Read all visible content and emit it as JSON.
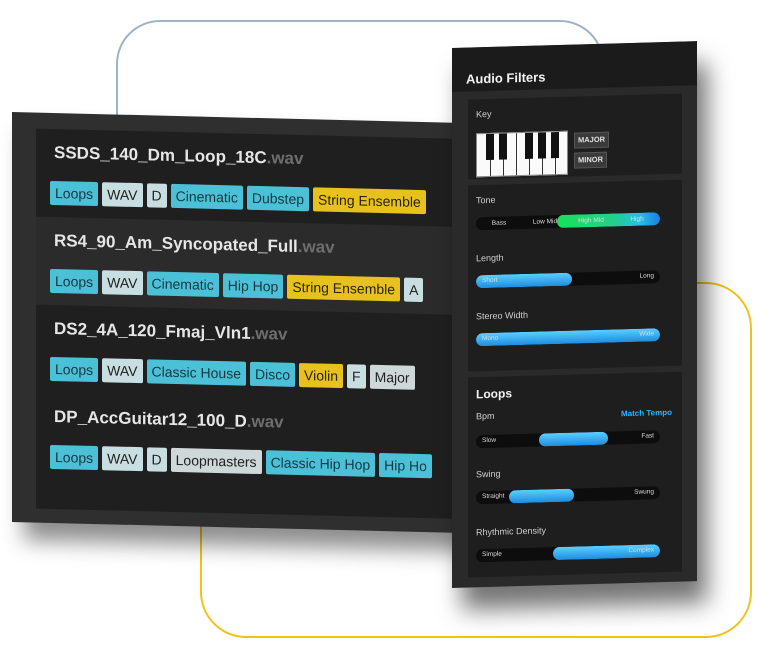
{
  "samples": [
    {
      "name": "SSDS_140_Dm_Loop_18C",
      "ext": ".wav",
      "tags": [
        {
          "label": "Loops",
          "kind": "cat"
        },
        {
          "label": "WAV",
          "kind": "fmt"
        },
        {
          "label": "D",
          "kind": "fmt"
        },
        {
          "label": "Cinematic",
          "kind": "cat"
        },
        {
          "label": "Dubstep",
          "kind": "cat"
        },
        {
          "label": "String Ensemble",
          "kind": "inst"
        }
      ]
    },
    {
      "name": "RS4_90_Am_Syncopated_Full",
      "ext": ".wav",
      "tags": [
        {
          "label": "Loops",
          "kind": "cat"
        },
        {
          "label": "WAV",
          "kind": "fmt"
        },
        {
          "label": "Cinematic",
          "kind": "cat"
        },
        {
          "label": "Hip Hop",
          "kind": "cat"
        },
        {
          "label": "String Ensemble",
          "kind": "inst"
        },
        {
          "label": "A",
          "kind": "fmt"
        }
      ]
    },
    {
      "name": "DS2_4A_120_Fmaj_Vln1",
      "ext": ".wav",
      "tags": [
        {
          "label": "Loops",
          "kind": "cat"
        },
        {
          "label": "WAV",
          "kind": "fmt"
        },
        {
          "label": "Classic House",
          "kind": "cat"
        },
        {
          "label": "Disco",
          "kind": "cat"
        },
        {
          "label": "Violin",
          "kind": "inst"
        },
        {
          "label": "F",
          "kind": "fmt"
        },
        {
          "label": "Major",
          "kind": "light"
        }
      ]
    },
    {
      "name": "DP_AccGuitar12_100_D",
      "ext": ".wav",
      "tags": [
        {
          "label": "Loops",
          "kind": "cat"
        },
        {
          "label": "WAV",
          "kind": "fmt"
        },
        {
          "label": "D",
          "kind": "fmt"
        },
        {
          "label": "Loopmasters",
          "kind": "light"
        },
        {
          "label": "Classic Hip Hop",
          "kind": "cat"
        },
        {
          "label": "Hip Ho",
          "kind": "cat"
        }
      ]
    }
  ],
  "filters": {
    "title": "Audio Filters",
    "key": {
      "label": "Key",
      "major": "MAJOR",
      "minor": "MINOR"
    },
    "tone": {
      "label": "Tone",
      "bands": [
        "Bass",
        "Low Mid",
        "High Mid",
        "High"
      ],
      "active_from": 0.44,
      "active_to": 1.0
    },
    "length": {
      "label": "Length",
      "min_label": "Short",
      "max_label": "Long",
      "level": 0.52
    },
    "stereo_width": {
      "label": "Stereo Width",
      "min_label": "Mono",
      "max_label": "Wide",
      "level": 1.0
    }
  },
  "loops": {
    "title": "Loops",
    "bpm": {
      "label": "Bpm",
      "link": "Match Tempo",
      "min_label": "Slow",
      "max_label": "Fast",
      "from": 0.34,
      "to": 0.72
    },
    "swing": {
      "label": "Swing",
      "min_label": "Straight",
      "max_label": "Swung",
      "from": 0.18,
      "to": 0.53
    },
    "density": {
      "label": "Rhythmic Density",
      "min_label": "Simple",
      "max_label": "Complex",
      "from": 0.42,
      "to": 1.0
    }
  }
}
